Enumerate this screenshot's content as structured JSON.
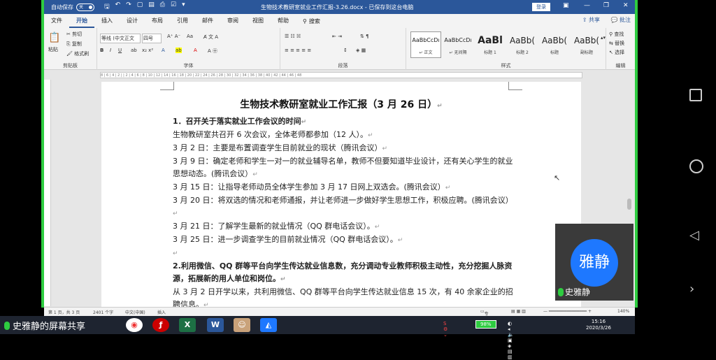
{
  "titlebar": {
    "autosave_label": "自动保存",
    "autosave_state": "关",
    "doc_title": "生物技术教研室就业工作汇报-3.26.docx - 已保存到这台电脑",
    "login": "登录",
    "icons": [
      "save-icon",
      "undo-icon",
      "redo-icon",
      "new-doc-icon",
      "open-icon",
      "print-icon",
      "check-icon",
      "more-icon"
    ]
  },
  "menubar": {
    "items": [
      "文件",
      "开始",
      "插入",
      "设计",
      "布局",
      "引用",
      "邮件",
      "审阅",
      "视图",
      "帮助"
    ],
    "active": "开始",
    "search": "搜索",
    "share": "共享",
    "comment": "批注"
  },
  "ribbon": {
    "clipboard": {
      "label": "剪贴板",
      "paste": "粘贴",
      "cut": "剪切",
      "copy": "复制",
      "format_painter": "格式刷"
    },
    "font": {
      "label": "字体",
      "font_name": "等线 (中文正文",
      "font_size": "四号",
      "aa": "Aa"
    },
    "paragraph": {
      "label": "段落"
    },
    "styles": {
      "label": "样式",
      "items": [
        {
          "sample": "AaBbCcDı",
          "name": "↵ 正文"
        },
        {
          "sample": "AaBbCcDı",
          "name": "↵ 无间隔"
        },
        {
          "sample": "AaBl",
          "name": "标题 1"
        },
        {
          "sample": "AaBb(",
          "name": "标题 2"
        },
        {
          "sample": "AaBb(",
          "name": "标题"
        },
        {
          "sample": "AaBb(",
          "name": "副标题"
        }
      ]
    },
    "editing": {
      "label": "编辑",
      "find": "查找",
      "replace": "替换",
      "select": "选择"
    }
  },
  "ruler": {
    "ticks": "8 | 6 | 4 | 2 | | 2 | 4 | 6 | 8 | 10 | 12 | 14 | 16 | 18 | 20 | 22 | 24 | 26 | 28 | 30 | 32 | 34 | 36 | 38 | 40 | 42 | 44 | 46 | 48"
  },
  "document": {
    "heading": "生物技术教研室就业工作汇报（3 月 26 日）",
    "paragraphs": [
      {
        "text": "1．召开关于落实就业工作会议的时间",
        "bold": true
      },
      {
        "text": "生物教研室共召开 6 次会议，全体老师都参加（12 人）。",
        "bold": false
      },
      {
        "text": "3 月 2 日：主要是布置调查学生目前就业的现状（腾讯会议）",
        "bold": false
      },
      {
        "text": "3 月 9 日：确定老师和学生一对一的就业辅导名单，教师不但要知道毕业设计，还有关心学生的就业思想动态。(腾讯会议）",
        "bold": false
      },
      {
        "text": "3 月 15 日：让指导老师动员全体学生参加 3 月 17 日网上双选会。(腾讯会议）",
        "bold": false
      },
      {
        "text": "3 月 20 日：将双选的情况和老师通报，并让老师进一步做好学生思想工作，积极应聘。(腾讯会议）",
        "bold": false
      },
      {
        "text": "3 月 21 日：了解学生最新的就业情况（QQ 群电话会议）。",
        "bold": false
      },
      {
        "text": "3 月 25 日：进一步调查学生的目前就业情况（QQ 群电话会议）。",
        "bold": false
      },
      {
        "text": "",
        "bold": false
      },
      {
        "text": "2.利用微信、QQ 群等平台向学生传达就业信息数，充分调动专业教师积极主动性，充分挖掘人脉资源，拓展新的用人单位和岗位。",
        "bold": true
      },
      {
        "text": "从 3 月 2 日开学以来，共利用微信、QQ 群等平台向学生传达就业信息 15 次，有 40 余家企业的招聘信息。",
        "bold": false
      }
    ]
  },
  "statusbar": {
    "page": "第 1 页，共 3 页",
    "words": "2401 个字",
    "lang": "中文(中国)",
    "mode": "插入",
    "focus": "专注",
    "zoom": "140%"
  },
  "video": {
    "avatar_text": "雅静",
    "name": "史雅静"
  },
  "taskbar": {
    "share_label": "史雅静的屏幕共享",
    "battery": "98%",
    "time": "15:16",
    "date": "2020/3/26"
  }
}
